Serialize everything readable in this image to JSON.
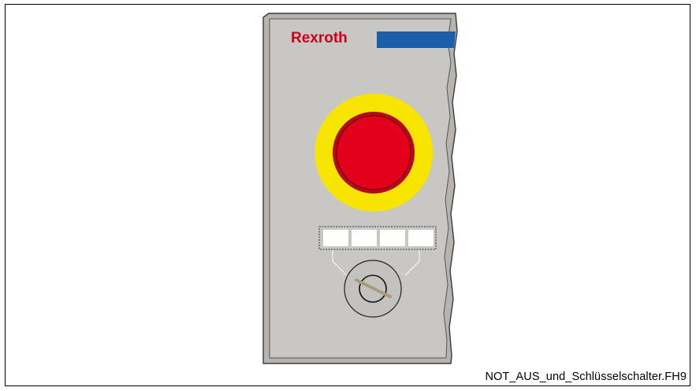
{
  "brand": {
    "text": "Rexroth",
    "color": "#d0001b",
    "bar_color": "#1d5ea8"
  },
  "panel": {
    "face_color": "#c9c7c3",
    "emergency_stop_color": "#e2001a",
    "emergency_stop_ring_color": "#f7e400",
    "label_slot_count": 4,
    "key_switch_icon": "key-switch-icon"
  },
  "caption": {
    "text": "NOT_AUS_und_Schlüsselschalter.FH9"
  }
}
